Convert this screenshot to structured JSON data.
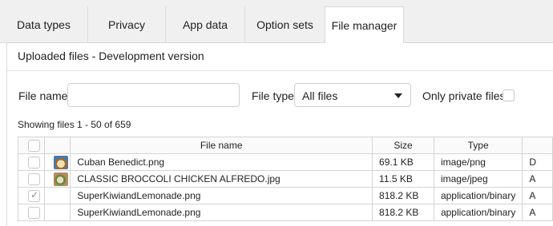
{
  "tabs": [
    {
      "label": "Data types",
      "active": false
    },
    {
      "label": "Privacy",
      "active": false
    },
    {
      "label": "App data",
      "active": false
    },
    {
      "label": "Option sets",
      "active": false
    },
    {
      "label": "File manager",
      "active": true
    }
  ],
  "panel": {
    "title": "Uploaded files - Development version"
  },
  "filters": {
    "file_name_label": "File name",
    "file_name_value": "",
    "file_type_label": "File type",
    "file_type_value": "All files",
    "private_label": "Only private files",
    "private_checked": false
  },
  "showing": "Showing files 1 - 50 of 659",
  "table": {
    "headers": {
      "name": "File name",
      "size": "Size",
      "type": "Type"
    },
    "rows": [
      {
        "checked": false,
        "thumb": "cuban-benedict-thumbnail",
        "name": "Cuban Benedict.png",
        "size": "69.1 KB",
        "type": "image/png",
        "extra": "D"
      },
      {
        "checked": false,
        "thumb": "broccoli-chicken-thumbnail",
        "name": "CLASSIC BROCCOLI CHICKEN ALFREDO.jpg",
        "size": "11.5 KB",
        "type": "image/jpeg",
        "extra": "A"
      },
      {
        "checked": true,
        "thumb": "",
        "name": "SuperKiwiandLemonade.png",
        "size": "818.2 KB",
        "type": "application/binary",
        "extra": "A"
      },
      {
        "checked": false,
        "thumb": "",
        "name": "SuperKiwiandLemonade.png",
        "size": "818.2 KB",
        "type": "application/binary",
        "extra": "A"
      }
    ]
  },
  "colors": {
    "tab_bg": "#f0f0f0",
    "active_tab_bg": "#ffffff",
    "border": "#d4d4d4"
  }
}
